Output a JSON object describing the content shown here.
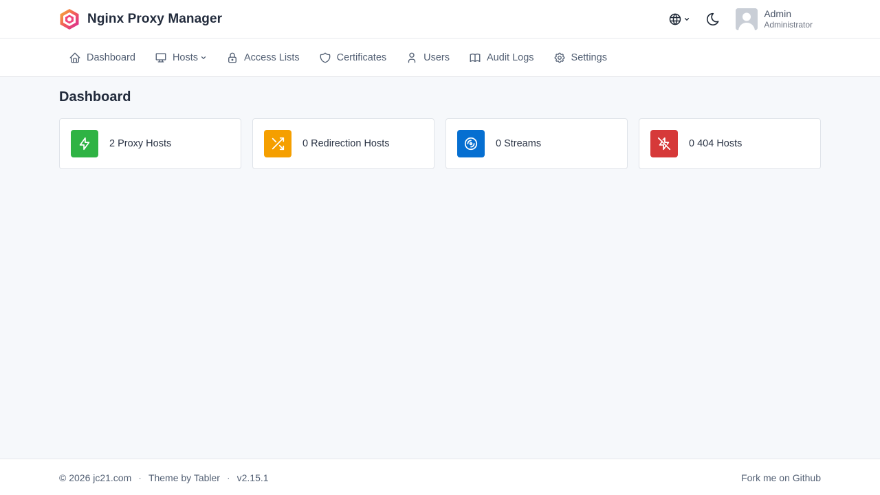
{
  "header": {
    "app_name": "Nginx Proxy Manager",
    "logo_icon": "npm-hexagon-logo",
    "user": {
      "name": "Admin",
      "role": "Administrator"
    }
  },
  "nav": {
    "items": [
      {
        "label": "Dashboard",
        "icon": "home-icon"
      },
      {
        "label": "Hosts",
        "icon": "monitor-icon",
        "has_dropdown": true
      },
      {
        "label": "Access Lists",
        "icon": "lock-icon"
      },
      {
        "label": "Certificates",
        "icon": "shield-icon"
      },
      {
        "label": "Users",
        "icon": "user-icon"
      },
      {
        "label": "Audit Logs",
        "icon": "book-icon"
      },
      {
        "label": "Settings",
        "icon": "gear-icon"
      }
    ]
  },
  "main": {
    "title": "Dashboard",
    "cards": [
      {
        "label": "2 Proxy Hosts",
        "icon": "bolt-icon",
        "color": "#2fb344"
      },
      {
        "label": "0 Redirection Hosts",
        "icon": "shuffle-icon",
        "color": "#f59f00"
      },
      {
        "label": "0 Streams",
        "icon": "disc-icon",
        "color": "#066fd1"
      },
      {
        "label": "0 404 Hosts",
        "icon": "bolt-off-icon",
        "color": "#d63939"
      }
    ]
  },
  "footer": {
    "copyright": "© 2026 jc21.com",
    "theme_credit": "Theme by Tabler",
    "version": "v2.15.1",
    "github_link": "Fork me on Github"
  },
  "colors": {
    "background": "#f6f8fb",
    "surface": "#ffffff",
    "border": "#e6e8ec"
  }
}
